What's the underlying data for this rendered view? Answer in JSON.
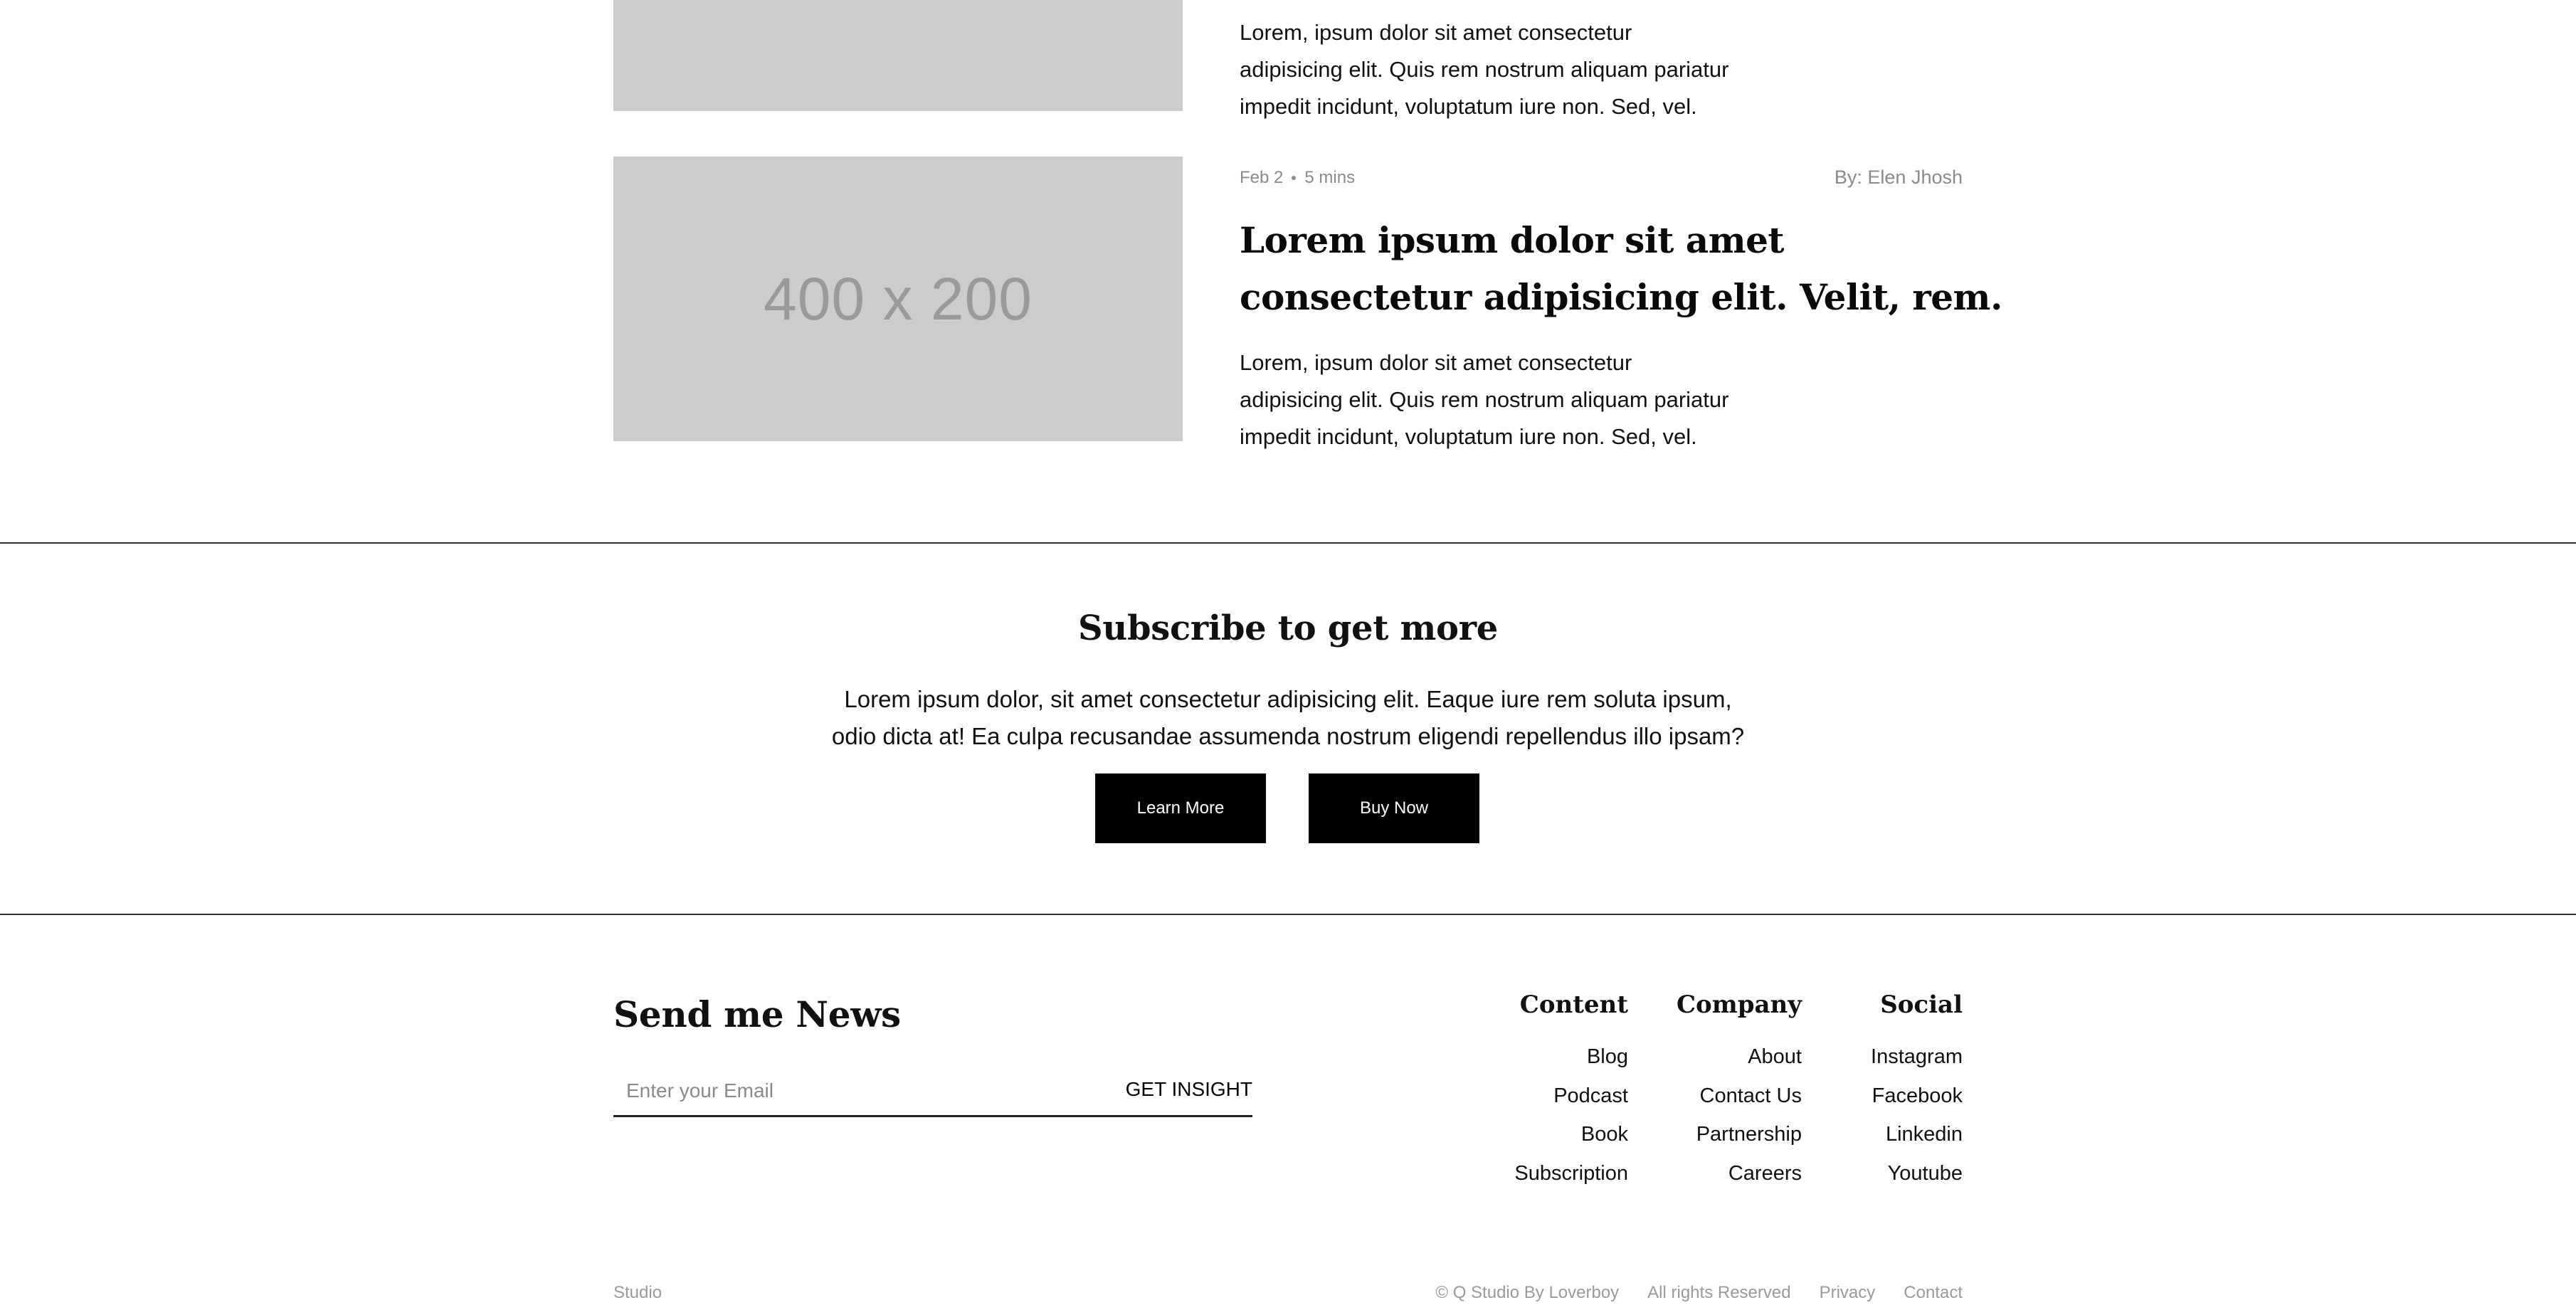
{
  "posts": [
    {
      "image_label": "",
      "excerpt": [
        "Lorem, ipsum dolor sit amet consectetur",
        "adipisicing elit. Quis rem nostrum aliquam pariatur",
        "impedit incidunt, voluptatum iure non. Sed, vel."
      ]
    },
    {
      "image_label": "400 x 200",
      "date": "Feb 2",
      "read_time": "5 mins",
      "author": "By: Elen Jhosh",
      "title": [
        "Lorem ipsum dolor sit amet",
        "consectetur adipisicing elit. Velit, rem."
      ],
      "excerpt": [
        "Lorem, ipsum dolor sit amet consectetur",
        "adipisicing elit. Quis rem nostrum aliquam pariatur",
        "impedit incidunt, voluptatum iure non. Sed, vel."
      ]
    }
  ],
  "subscribe": {
    "title": "Subscribe to get more",
    "text": [
      "Lorem ipsum dolor, sit amet consectetur adipisicing elit. Eaque iure rem soluta ipsum,",
      "odio dicta at! Ea culpa recusandae assumenda nostrum eligendi repellendus illo ipsam?"
    ],
    "learn_more": "Learn More",
    "buy_now": "Buy Now"
  },
  "footer": {
    "news_title": "Send me News",
    "email_placeholder": "Enter your Email",
    "submit_label": "GET INSIGHT",
    "columns": [
      {
        "heading": "Content",
        "links": [
          "Blog",
          "Podcast",
          "Book",
          "Subscription"
        ]
      },
      {
        "heading": "Company",
        "links": [
          "About",
          "Contact Us",
          "Partnership",
          "Careers"
        ]
      },
      {
        "heading": "Social",
        "links": [
          "Instagram",
          "Facebook",
          "Linkedin",
          "Youtube"
        ]
      }
    ],
    "bottom_left": "Studio",
    "copyright": "© Q Studio By Loverboy",
    "rights": "All rights Reserved",
    "privacy": "Privacy",
    "contact": "Contact"
  },
  "colors": {
    "placeholder_bg": "#cccccc",
    "button_bg": "#000000",
    "muted_text": "#8a8a8a"
  }
}
